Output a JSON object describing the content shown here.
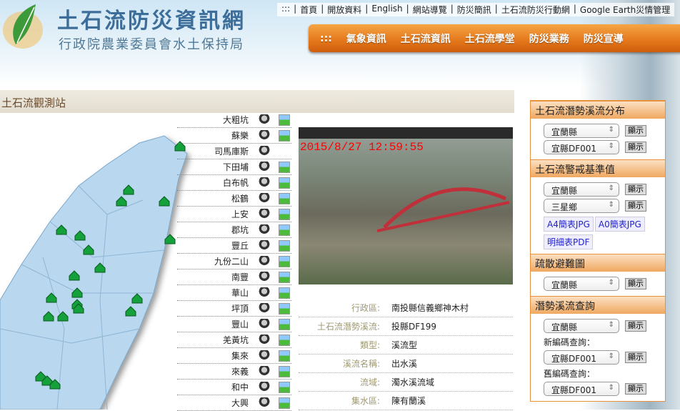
{
  "header": {
    "title": "土石流防災資訊網",
    "subtitle": "行政院農業委員會水土保持局"
  },
  "top_links": [
    ":::",
    "首頁",
    "開放資料",
    "English",
    "網站導覽",
    "防災簡訊",
    "土石流防災行動網",
    "Google Earth災情管理"
  ],
  "nav": [
    ":::",
    "氣象資訊",
    "土石流資訊",
    "土石流學堂",
    "防災業務",
    "防災宣導"
  ],
  "section_title": "土石流觀測站",
  "stations": [
    {
      "name": "大粗坑",
      "image": true
    },
    {
      "name": "蘇樂",
      "image": true
    },
    {
      "name": "司馬庫斯",
      "image": false
    },
    {
      "name": "下田埔",
      "image": true
    },
    {
      "name": "白布帆",
      "image": true
    },
    {
      "name": "松鶴",
      "image": true
    },
    {
      "name": "上安",
      "image": true
    },
    {
      "name": "郡坑",
      "image": true
    },
    {
      "name": "豐丘",
      "image": true
    },
    {
      "name": "九份二山",
      "image": true
    },
    {
      "name": "南豐",
      "image": true
    },
    {
      "name": "華山",
      "image": true
    },
    {
      "name": "坪頂",
      "image": true
    },
    {
      "name": "豐山",
      "image": true
    },
    {
      "name": "羌黃坑",
      "image": true
    },
    {
      "name": "集來",
      "image": true
    },
    {
      "name": "來義",
      "image": true
    },
    {
      "name": "和中",
      "image": true
    },
    {
      "name": "大興",
      "image": true
    }
  ],
  "camera": {
    "timestamp": "2015/8/27 12:59:55"
  },
  "info": [
    {
      "k": "行政區:",
      "v": "南投縣信義鄉神木村"
    },
    {
      "k": "土石流潛勢溪流:",
      "v": "投縣DF199"
    },
    {
      "k": "類型:",
      "v": "溪流型"
    },
    {
      "k": "溪流名稱:",
      "v": "出水溪"
    },
    {
      "k": "流域:",
      "v": "濁水溪流域"
    },
    {
      "k": "集水區:",
      "v": "陳有蘭溪"
    }
  ],
  "panel": {
    "show": "顯示",
    "p1": {
      "title": "土石流潛勢溪流分布",
      "sel1": "宜蘭縣",
      "sel2": "宜縣DF001"
    },
    "p2": {
      "title": "土石流警戒基準值",
      "sel1": "宜蘭縣",
      "sel2": "三星鄉",
      "l1": "A4簡表JPG",
      "l2": "A0簡表JPG",
      "l3": "明細表PDF"
    },
    "p3": {
      "title": "疏散避難圖",
      "sel1": "宜蘭縣"
    },
    "p4": {
      "title": "潛勢溪流查詢",
      "sel1": "宜蘭縣",
      "lbl_new": "新編碼查詢：",
      "sel2": "宜縣DF001",
      "lbl_old": "舊編碼查詢：",
      "sel3": "宜縣DF001"
    }
  }
}
